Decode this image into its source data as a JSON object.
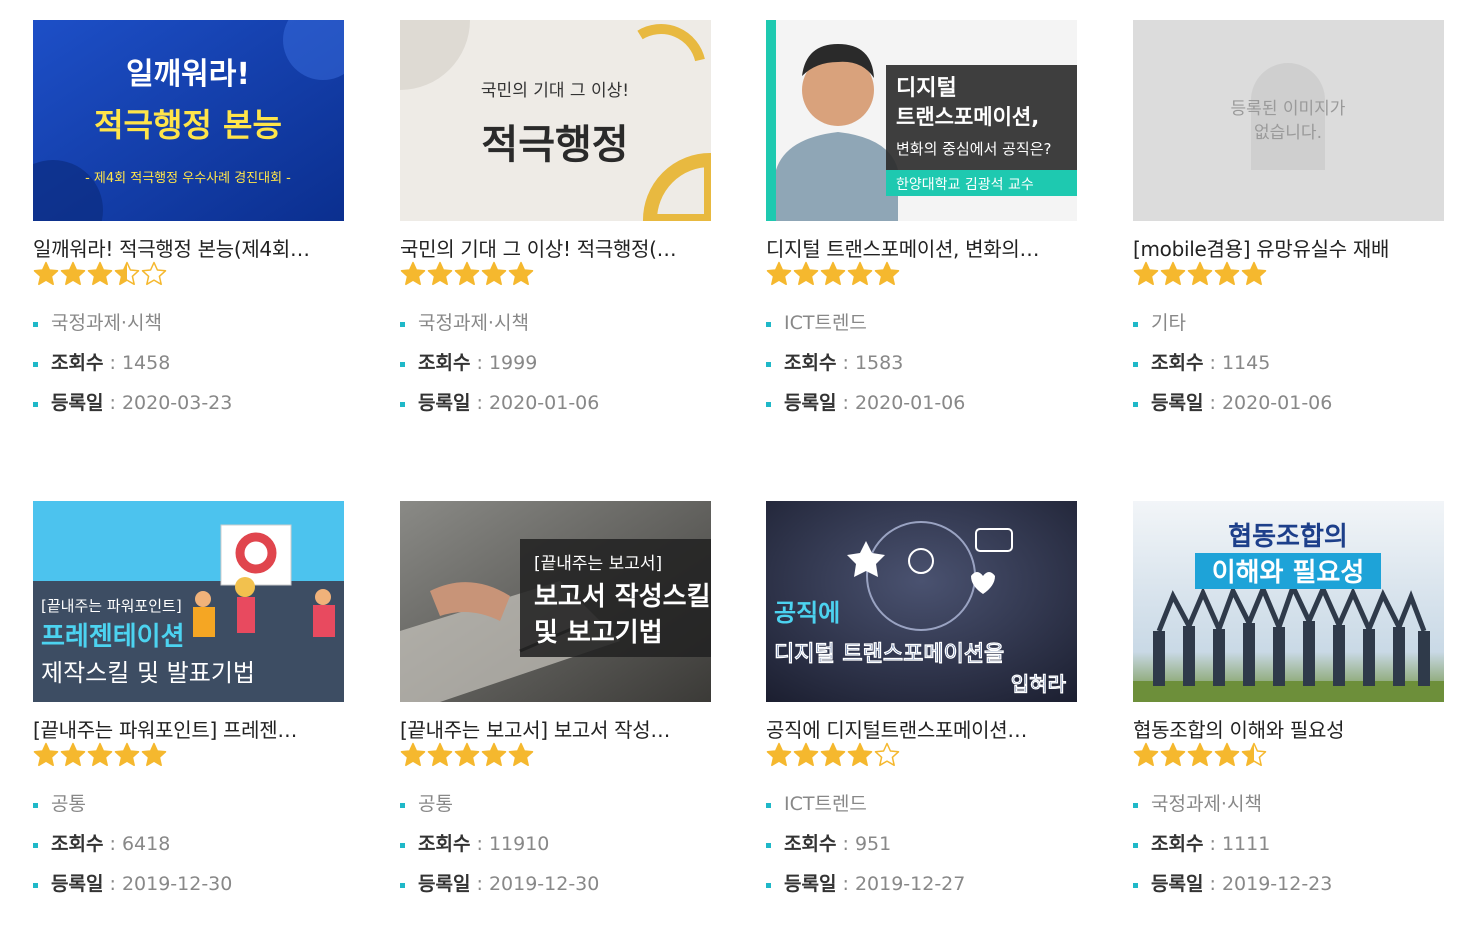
{
  "courses": [
    {
      "title": "일깨워라! 적극행정 본능(제4회…",
      "rating": 3.5,
      "category": "국정과제·시책",
      "views_label": "조회수",
      "views": "1458",
      "date_label": "등록일",
      "date": "2020-03-23",
      "thumb": {
        "line1": "일깨워라!",
        "line2": "적극행정 본능",
        "line3": "- 제4회 적극행정 우수사례 경진대회 -"
      }
    },
    {
      "title": "국민의 기대 그 이상! 적극행정(…",
      "rating": 5,
      "category": "국정과제·시책",
      "views_label": "조회수",
      "views": "1999",
      "date_label": "등록일",
      "date": "2020-01-06",
      "thumb": {
        "line1": "국민의 기대 그 이상!",
        "line2": "적극행정"
      }
    },
    {
      "title": "디지털 트랜스포메이션, 변화의…",
      "rating": 5,
      "category": "ICT트렌드",
      "views_label": "조회수",
      "views": "1583",
      "date_label": "등록일",
      "date": "2020-01-06",
      "thumb": {
        "line1": "디지털",
        "line2": "트랜스포메이션,",
        "line3": "변화의 중심에서 공직은?",
        "line4": "한양대학교 김광석 교수"
      }
    },
    {
      "title": "[mobile겸용] 유망유실수 재배",
      "rating": 5,
      "category": "기타",
      "views_label": "조회수",
      "views": "1145",
      "date_label": "등록일",
      "date": "2020-01-06",
      "thumb": {
        "line1": "등록된 이미지가",
        "line2": "없습니다."
      }
    },
    {
      "title": "[끝내주는 파워포인트] 프레젠…",
      "rating": 5,
      "category": "공통",
      "views_label": "조회수",
      "views": "6418",
      "date_label": "등록일",
      "date": "2019-12-30",
      "thumb": {
        "line1": "[끝내주는 파워포인트]",
        "line2": "프레젠테이션",
        "line3": "제작스킬 및 발표기법"
      }
    },
    {
      "title": "[끝내주는 보고서] 보고서 작성…",
      "rating": 5,
      "category": "공통",
      "views_label": "조회수",
      "views": "11910",
      "date_label": "등록일",
      "date": "2019-12-30",
      "thumb": {
        "line1": "[끝내주는 보고서]",
        "line2": "보고서 작성스킬",
        "line3": "및 보고기법"
      }
    },
    {
      "title": "공직에 디지털트랜스포메이션…",
      "rating": 4,
      "category": "ICT트렌드",
      "views_label": "조회수",
      "views": "951",
      "date_label": "등록일",
      "date": "2019-12-27",
      "thumb": {
        "line1": "공직에",
        "line2": "디지털 트랜스포메이션을",
        "line3": "입혀라"
      }
    },
    {
      "title": "협동조합의 이해와 필요성",
      "rating": 4.5,
      "category": "국정과제·시책",
      "views_label": "조회수",
      "views": "1111",
      "date_label": "등록일",
      "date": "2019-12-23",
      "thumb": {
        "line1": "협동조합의",
        "line2": "이해와 필요성"
      }
    }
  ],
  "colors": {
    "star": "#f5b82e",
    "bullet": "#1fb8c8",
    "accent_teal": "#1ec9b0"
  }
}
